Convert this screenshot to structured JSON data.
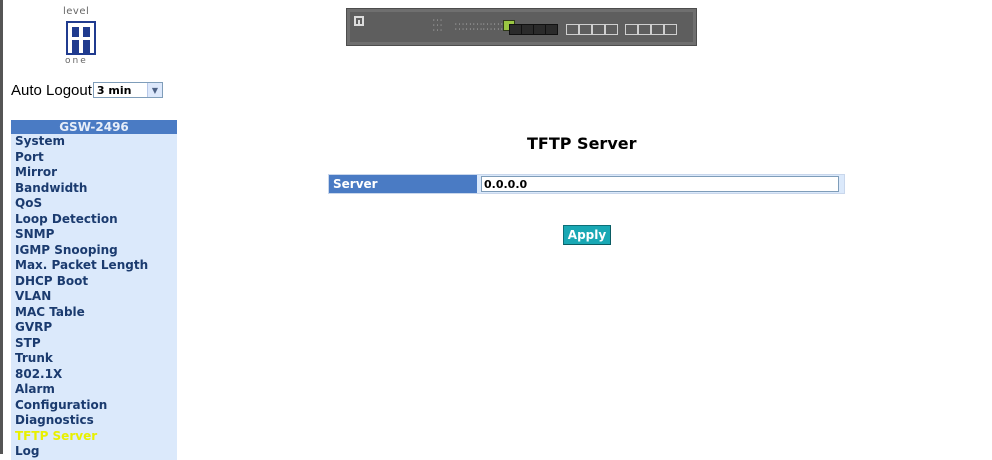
{
  "logo": {
    "top_text": "level",
    "bottom_text": "one"
  },
  "auto_logout": {
    "label": "Auto Logout",
    "selected": "3 min"
  },
  "menu": {
    "title": "GSW-2496",
    "items": [
      "System",
      "Port",
      "Mirror",
      "Bandwidth",
      "QoS",
      "Loop Detection",
      "SNMP",
      "IGMP Snooping",
      "Max. Packet Length",
      "DHCP Boot",
      "VLAN",
      "MAC Table",
      "GVRP",
      "STP",
      "Trunk",
      "802.1X",
      "Alarm",
      "Configuration",
      "Diagnostics",
      "TFTP Server",
      "Log"
    ],
    "active_item": "TFTP Server"
  },
  "content": {
    "title": "TFTP Server",
    "server_label": "Server",
    "server_value": "0.0.0.0",
    "apply_label": "Apply"
  },
  "colors": {
    "menu_header": "#4a7bc4",
    "menu_bg": "#dbe9fb",
    "menu_text": "#1b3b6f",
    "menu_active_text": "#e8f000",
    "apply_button": "#19a8b4"
  }
}
